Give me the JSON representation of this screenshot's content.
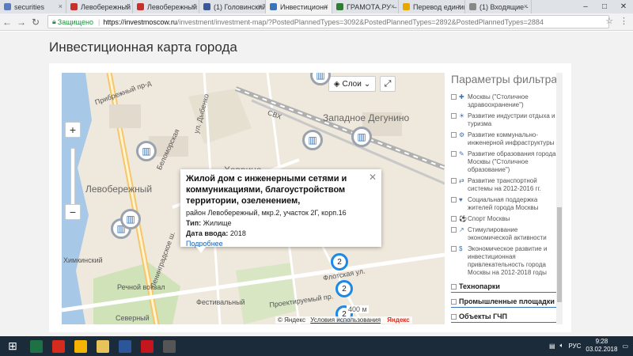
{
  "browser": {
    "tabs": [
      {
        "label": "securities",
        "color": "#5a7bbf",
        "active": false
      },
      {
        "label": "Левобережный",
        "color": "#c9302c",
        "active": false
      },
      {
        "label": "Левобережный",
        "color": "#c9302c",
        "active": false
      },
      {
        "label": "(1) Головинский",
        "color": "#3b5998",
        "active": false
      },
      {
        "label": "Инвестиционн",
        "color": "#3a74b8",
        "active": true
      },
      {
        "label": "ГРАМОТА.РУ –",
        "color": "#2e7d32",
        "active": false
      },
      {
        "label": "Перевод единиц",
        "color": "#e6a700",
        "active": false
      },
      {
        "label": "(1) Входящие -",
        "color": "#888888",
        "active": false
      }
    ],
    "secure_label": "Защищено",
    "url_host": "https://investmoscow.ru",
    "url_path": "/investment/investment-map/?PostedPlannedTypes=3092&PostedPlannedTypes=2892&PostedPlannedTypes=2884"
  },
  "page": {
    "title": "Инвестиционная карта города"
  },
  "map": {
    "layers_label": "Слои",
    "labels": [
      {
        "text": "Левобережный",
        "big": true
      },
      {
        "text": "Ховрино",
        "big": true
      },
      {
        "text": "Западное Дегунино",
        "big": true
      },
      {
        "text": "Речной вокзал",
        "big": false
      },
      {
        "text": "Ленинградское ш.",
        "big": false
      },
      {
        "text": "Фестивальный",
        "big": false
      },
      {
        "text": "Флотская ул.",
        "big": false
      },
      {
        "text": "Беломорская",
        "big": false
      },
      {
        "text": "ул. Дыбенко",
        "big": false
      },
      {
        "text": "Прибрежный пр-д",
        "big": false
      },
      {
        "text": "Северный",
        "big": false
      },
      {
        "text": "СВХ",
        "big": false
      },
      {
        "text": "Химкинский",
        "big": false
      },
      {
        "text": "Проектируемый пр.",
        "big": false
      }
    ],
    "clusters": [
      "2",
      "2",
      "2"
    ],
    "scale_label": "400 м",
    "copyright": "© Яндекс",
    "terms": "Условия использования",
    "yandex": "Яндекс",
    "balloon": {
      "title": "Жилой дом с инженерными сетями и коммуникациями, благоустройством территории, озеленением,",
      "address": "район Левобережный, мкр.2, участок 2Г, корп.16",
      "type_label": "Тип:",
      "type_value": "Жилище",
      "date_label": "Дата ввода:",
      "date_value": "2018",
      "more": "Подробнее"
    }
  },
  "filter": {
    "title": "Параметры фильтра",
    "items": [
      {
        "icon": "health-icon",
        "text": "Москвы (\"Столичное здравоохранение\")"
      },
      {
        "icon": "leisure-icon",
        "text": "Развитие индустрии отдыха и туризма"
      },
      {
        "icon": "utilities-icon",
        "text": "Развитие коммунально-инженерной инфраструктуры"
      },
      {
        "icon": "education-icon",
        "text": "Развитие образования города Москвы (\"Столичное образование\")"
      },
      {
        "icon": "transport-icon",
        "text": "Развитие транспортной системы на 2012-2016 гг."
      },
      {
        "icon": "social-icon",
        "text": "Социальная поддержка жителей города Москвы"
      },
      {
        "icon": "sport-icon",
        "text": "Спорт Москвы"
      },
      {
        "icon": "economy-icon",
        "text": "Стимулирование экономической активности"
      },
      {
        "icon": "investment-icon",
        "text": "Экономическое развитие и инвестиционная привлекательность города Москвы на 2012-2018 годы"
      }
    ],
    "groups": [
      "Технопарки",
      "Промышленные площадки",
      "Объекты ГЧП"
    ]
  },
  "taskbar": {
    "apps": [
      {
        "name": "excel-app",
        "color": "#1e7145"
      },
      {
        "name": "yandex-browser-app",
        "color": "#d52b1e"
      },
      {
        "name": "chrome-app",
        "color": "#f4b400"
      },
      {
        "name": "file-explorer-app",
        "color": "#e8c35a"
      },
      {
        "name": "word-app",
        "color": "#2b579a"
      },
      {
        "name": "acrobat-app",
        "color": "#c4161c"
      },
      {
        "name": "media-app",
        "color": "#555555"
      }
    ],
    "lang": "РУС",
    "time": "9:28",
    "date": "03.02.2018"
  }
}
